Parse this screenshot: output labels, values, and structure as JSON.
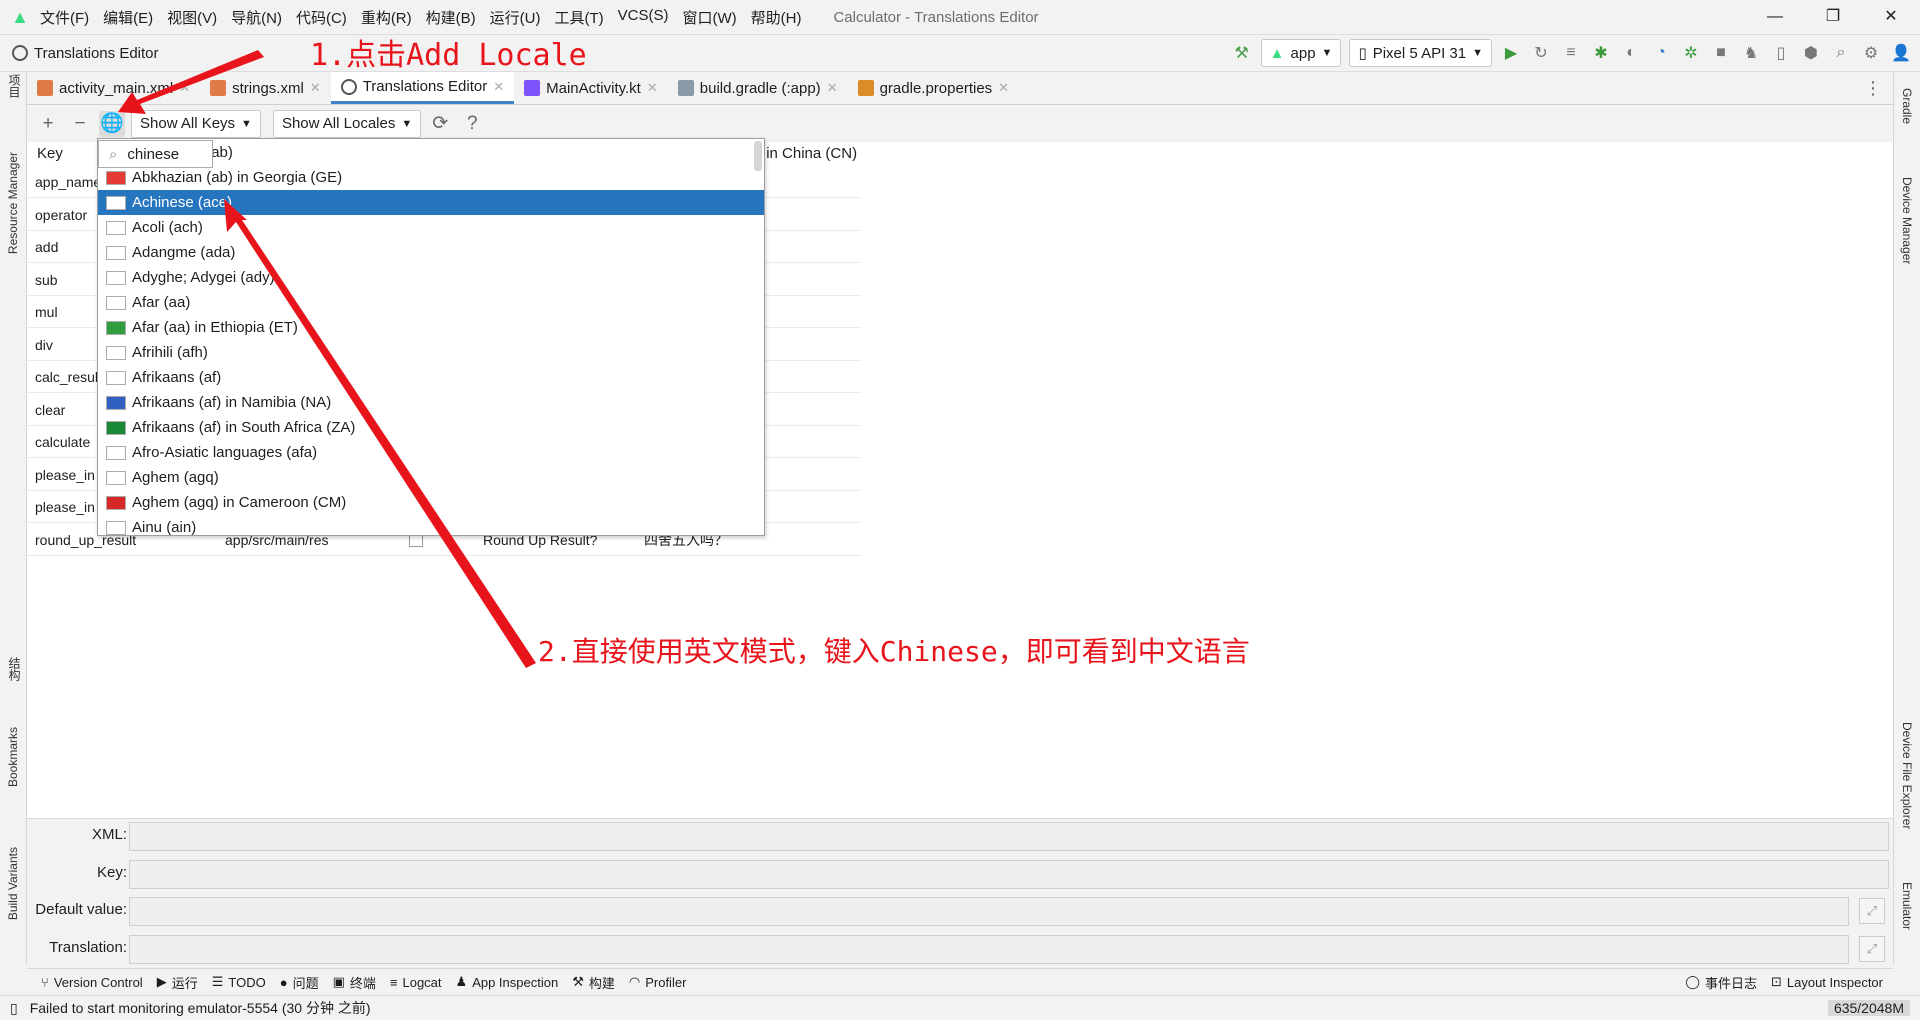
{
  "window": {
    "title": "Calculator - Translations Editor",
    "menu": [
      "文件(F)",
      "编辑(E)",
      "视图(V)",
      "导航(N)",
      "代码(C)",
      "重构(R)",
      "构建(B)",
      "运行(U)",
      "工具(T)",
      "VCS(S)",
      "窗口(W)",
      "帮助(H)"
    ]
  },
  "toolbar": {
    "breadcrumb": "Translations Editor",
    "run_config": "app",
    "device": "Pixel 5 API 31"
  },
  "left_stripe": [
    "项目",
    "Resource Manager",
    "结构",
    "Bookmarks",
    "Build Variants"
  ],
  "right_stripe": [
    "Gradle",
    "Device Manager",
    "Device File Explorer",
    "Emulator"
  ],
  "tabs": [
    {
      "label": "activity_main.xml",
      "icon": "xml-layout-icon",
      "active": false
    },
    {
      "label": "strings.xml",
      "icon": "xml-file-icon",
      "active": false
    },
    {
      "label": "Translations Editor",
      "icon": "globe-icon",
      "active": true
    },
    {
      "label": "MainActivity.kt",
      "icon": "kotlin-file-icon",
      "active": false
    },
    {
      "label": "build.gradle (:app)",
      "icon": "gradle-icon",
      "active": false
    },
    {
      "label": "gradle.properties",
      "icon": "properties-file-icon",
      "active": false
    }
  ],
  "editor_toolbar": {
    "keys_filter": "Show All Keys",
    "locales_filter": "Show All Locales",
    "help": "?"
  },
  "table": {
    "headers": {
      "key": "Key",
      "locale": "Chinese (zh) in China (CN)"
    },
    "keys": [
      "app_name",
      "operator",
      "add",
      "sub",
      "mul",
      "div",
      "calc_result",
      "clear",
      "calculate",
      "please_in",
      "please_in",
      "round_up_result"
    ],
    "last_row": {
      "folder": "app/src/main/res",
      "default": "Round Up Result?",
      "translation": "四舍五入吗？"
    }
  },
  "locale_popup": {
    "search": "chinese",
    "items": [
      {
        "label": "Abkhazian (ab)",
        "flag": false
      },
      {
        "label": "Abkhazian (ab) in Georgia (GE)",
        "flag": true,
        "flag_color": "#e53935"
      },
      {
        "label": "Achinese (ace)",
        "flag": false,
        "selected": true
      },
      {
        "label": "Acoli (ach)",
        "flag": false
      },
      {
        "label": "Adangme (ada)",
        "flag": false
      },
      {
        "label": "Adyghe; Adygei (ady)",
        "flag": false
      },
      {
        "label": "Afar (aa)",
        "flag": false
      },
      {
        "label": "Afar (aa) in Ethiopia (ET)",
        "flag": true,
        "flag_color": "#2e9e3f"
      },
      {
        "label": "Afrihili (afh)",
        "flag": false
      },
      {
        "label": "Afrikaans (af)",
        "flag": false
      },
      {
        "label": "Afrikaans (af) in Namibia (NA)",
        "flag": true,
        "flag_color": "#3060c0"
      },
      {
        "label": "Afrikaans (af) in South Africa (ZA)",
        "flag": true,
        "flag_color": "#1a8a3a"
      },
      {
        "label": "Afro-Asiatic languages (afa)",
        "flag": false
      },
      {
        "label": "Aghem (agq)",
        "flag": false
      },
      {
        "label": "Aghem (agq) in Cameroon (CM)",
        "flag": true,
        "flag_color": "#d62828"
      },
      {
        "label": "Ainu (ain)",
        "flag": false
      }
    ]
  },
  "properties": {
    "xml": "XML:",
    "key": "Key:",
    "default": "Default value:",
    "translation": "Translation:"
  },
  "tool_windows": [
    "Version Control",
    "运行",
    "TODO",
    "问题",
    "终端",
    "Logcat",
    "App Inspection",
    "构建",
    "Profiler"
  ],
  "tool_windows_right": [
    "事件日志",
    "Layout Inspector"
  ],
  "status": {
    "message": "Failed to start monitoring emulator-5554 (30 分钟 之前)",
    "memory": "635/2048M"
  },
  "annotations": {
    "step1": "1.点击Add Locale",
    "step2": "2.直接使用英文模式，键入Chinese，即可看到中文语言",
    "color": "#e8141b"
  }
}
